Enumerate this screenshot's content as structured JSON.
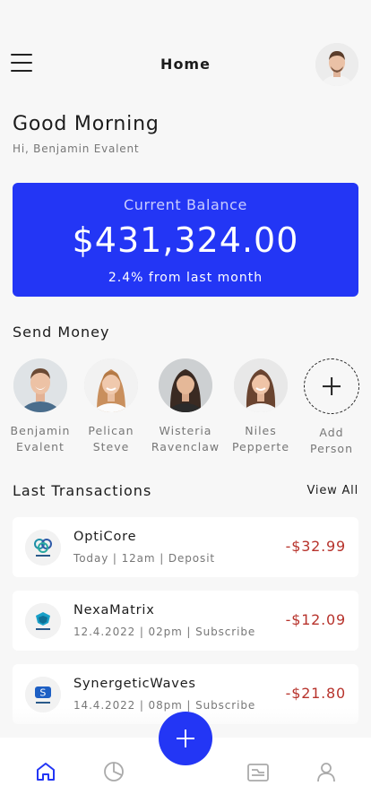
{
  "header": {
    "title": "Home",
    "menu_icon": "hamburger-menu-icon",
    "avatar_icon": "profile-avatar"
  },
  "greeting": {
    "title": "Good Morning",
    "subtitle": "Hi, Benjamin Evalent"
  },
  "balance": {
    "label": "Current Balance",
    "amount": "$431,324.00",
    "change": "2.4% from last month",
    "card_color": "#2336f5"
  },
  "send_money": {
    "title": "Send Money",
    "people": [
      {
        "name": "Benjamin\nEvalent"
      },
      {
        "name": "Pelican\nSteve"
      },
      {
        "name": "Wisteria\nRavenclaw"
      },
      {
        "name": "Niles\nPepperte"
      }
    ],
    "add_label": "Add\nPerson"
  },
  "transactions": {
    "title": "Last Transactions",
    "view_all": "View All",
    "items": [
      {
        "name": "OptiCore",
        "meta": "Today | 12am | Deposit",
        "amount": "-$32.99"
      },
      {
        "name": "NexaMatrix",
        "meta": "12.4.2022 | 02pm | Subscribe",
        "amount": "-$12.09"
      },
      {
        "name": "SynergeticWaves",
        "meta": "14.4.2022 | 08pm | Subscribe",
        "amount": "-$21.80"
      }
    ],
    "amount_color": "#b7332c"
  },
  "bottom_nav": {
    "items": [
      "home-icon",
      "pie-chart-icon",
      "wallet-icon",
      "user-icon"
    ],
    "fab_icon": "plus-icon",
    "active_color": "#2336f5"
  }
}
